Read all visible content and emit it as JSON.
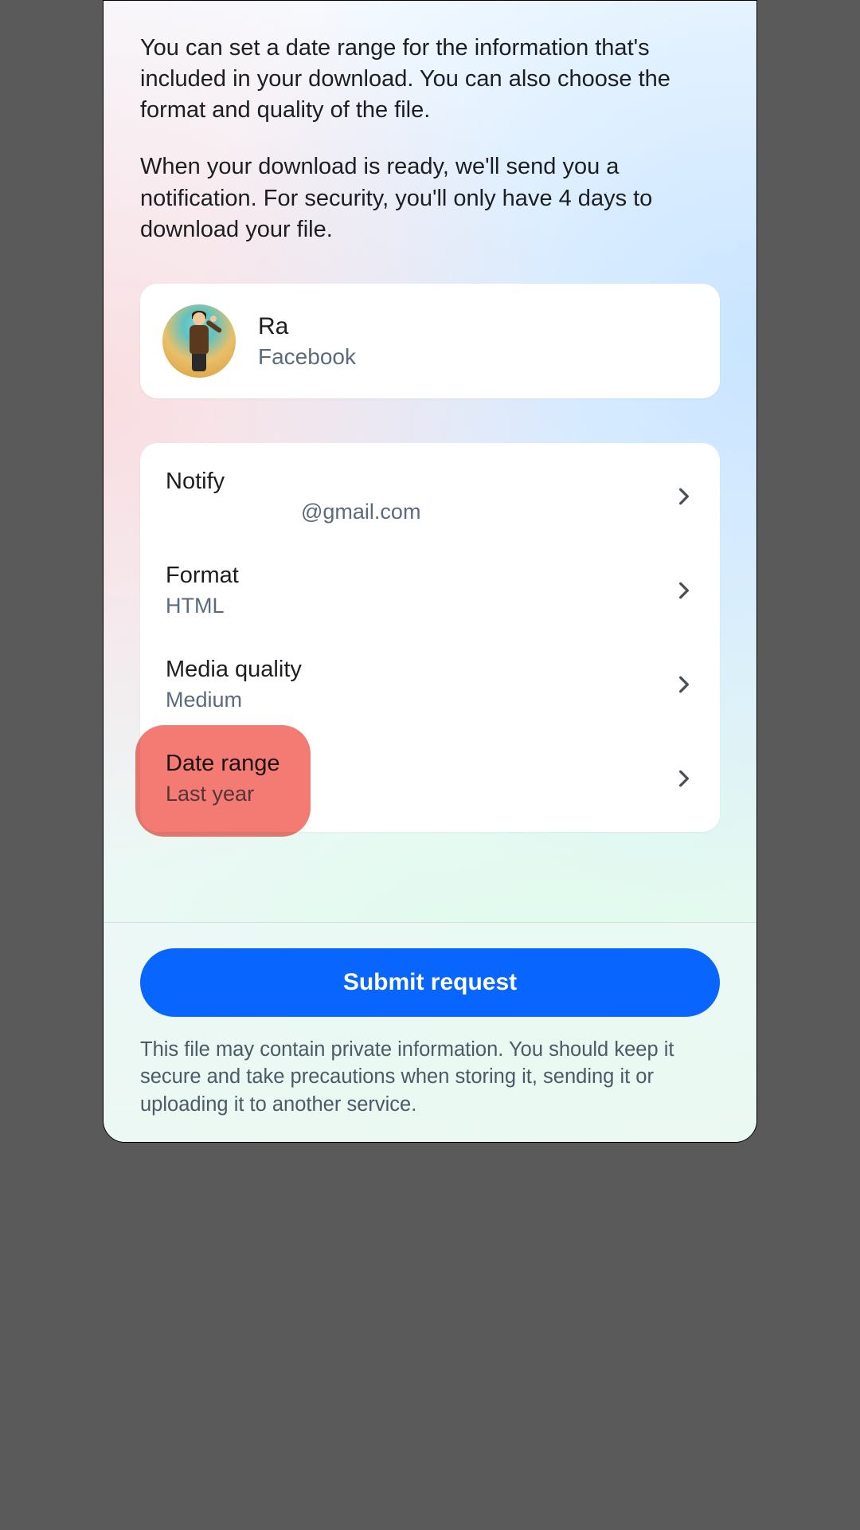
{
  "intro": {
    "p1": "You can set a date range for the information that's included in your download. You can also choose the format and quality of the file.",
    "p2": "When your download is ready, we'll send you a notification. For security, you'll only have 4 days to download your file."
  },
  "profile": {
    "name": "Ra",
    "platform": "Facebook"
  },
  "settings": {
    "notify": {
      "title": "Notify",
      "value": "@gmail.com"
    },
    "format": {
      "title": "Format",
      "value": "HTML"
    },
    "media_quality": {
      "title": "Media quality",
      "value": "Medium"
    },
    "date_range": {
      "title": "Date range",
      "value": "Last year"
    }
  },
  "submit_label": "Submit request",
  "disclaimer": "This file may contain private information. You should keep it secure and take precautions when storing it, sending it or uploading it to another service.",
  "highlight": {
    "target": "date-range"
  }
}
